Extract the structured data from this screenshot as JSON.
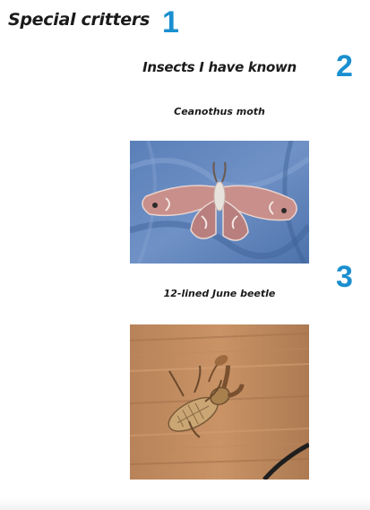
{
  "page": {
    "title": "Special critters"
  },
  "section": {
    "title": "Insects I have known"
  },
  "items": [
    {
      "caption": "Ceanothus moth",
      "photo": "moth-photo"
    },
    {
      "caption": "12-lined June beetle",
      "photo": "beetle-photo"
    }
  ],
  "markers": [
    "1",
    "2",
    "3"
  ],
  "colors": {
    "marker": "#1a8fd0",
    "text": "#1b1b1b",
    "background": "#ffffff"
  }
}
